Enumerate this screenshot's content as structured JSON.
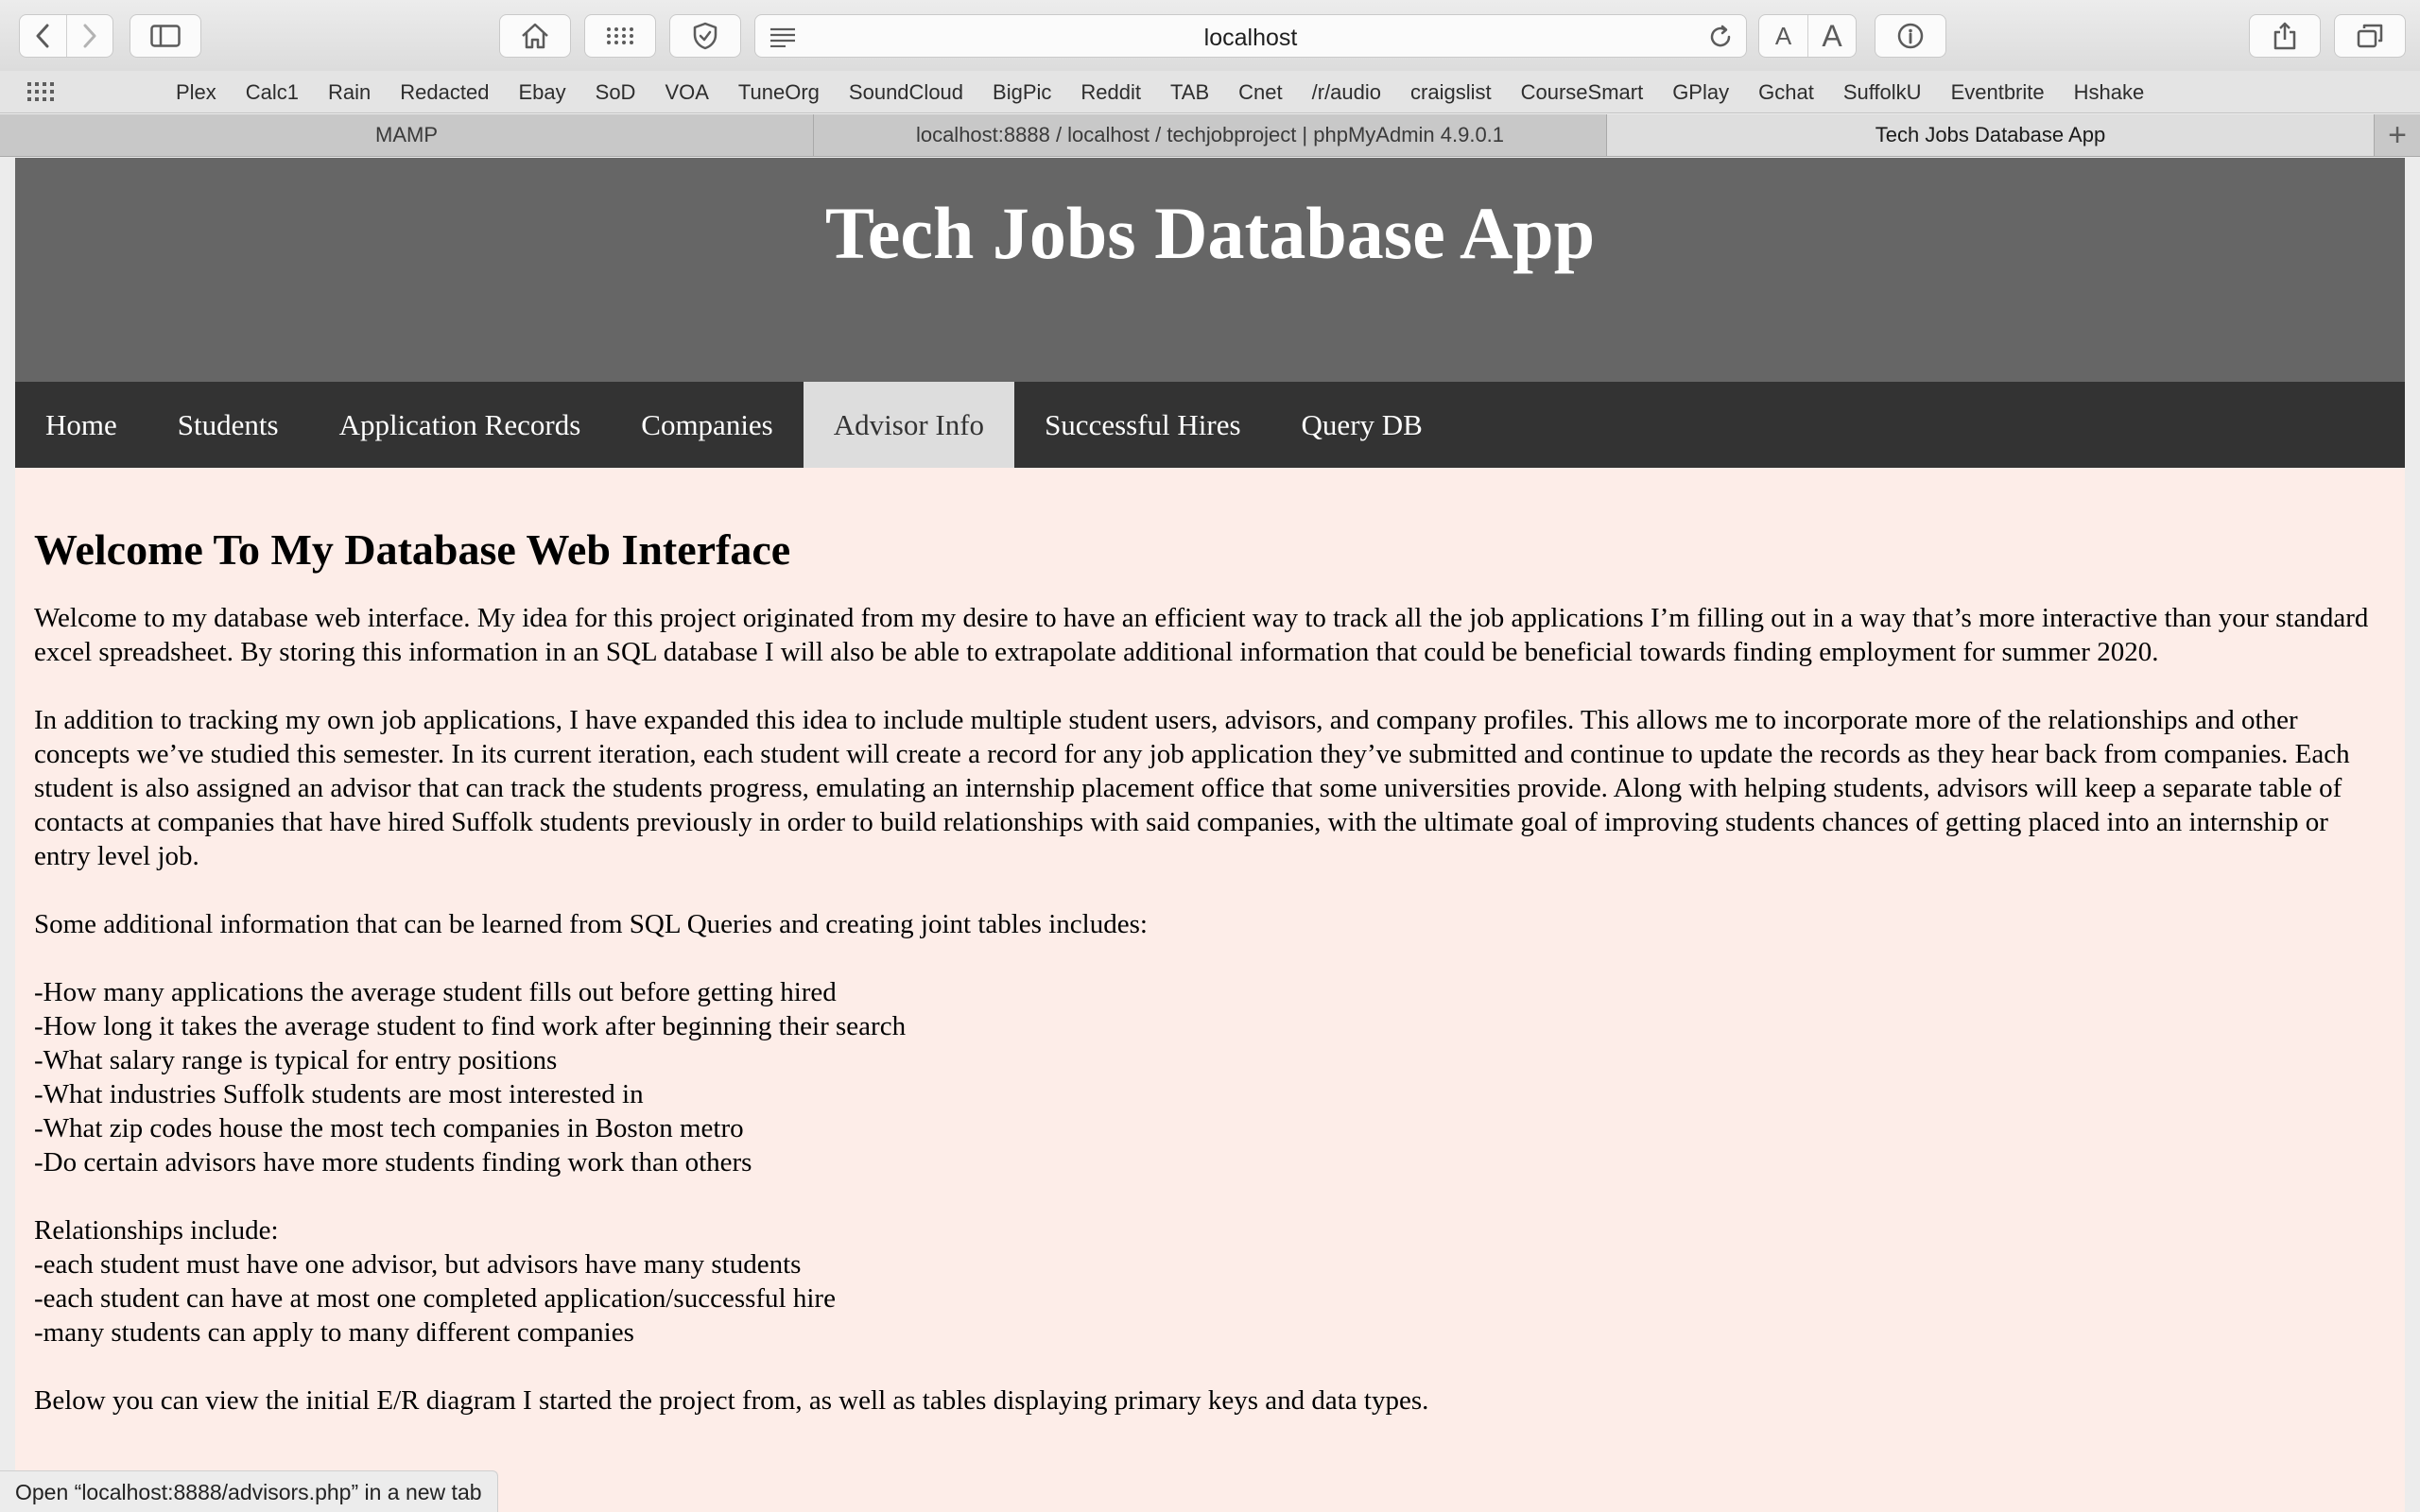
{
  "browser": {
    "address_url": "localhost",
    "favorites": [
      "Plex",
      "Calc1",
      "Rain",
      "Redacted",
      "Ebay",
      "SoD",
      "VOA",
      "TuneOrg",
      "SoundCloud",
      "BigPic",
      "Reddit",
      "TAB",
      "Cnet",
      "/r/audio",
      "craigslist",
      "CourseSmart",
      "GPlay",
      "Gchat",
      "SuffolkU",
      "Eventbrite",
      "Hshake"
    ],
    "tabs": [
      {
        "label": "MAMP"
      },
      {
        "label": "localhost:8888 / localhost / techjobproject | phpMyAdmin 4.9.0.1"
      },
      {
        "label": "Tech Jobs Database App"
      }
    ],
    "new_tab_label": "+",
    "font_small_label": "A",
    "font_large_label": "A",
    "status_text": "Open “localhost:8888/advisors.php” in a new tab"
  },
  "site": {
    "title": "Tech Jobs Database App",
    "nav": [
      {
        "label": "Home"
      },
      {
        "label": "Students"
      },
      {
        "label": "Application Records"
      },
      {
        "label": "Companies"
      },
      {
        "label": "Advisor Info"
      },
      {
        "label": "Successful Hires"
      },
      {
        "label": "Query DB"
      }
    ],
    "heading": "Welcome To My Database Web Interface",
    "intro1": "Welcome to my database web interface. My idea for this project originated from my desire to have an efficient way to track all the job applications I’m filling out in a way that’s more interactive than your standard excel spreadsheet. By storing this information in an SQL database I will also be able to extrapolate additional information that could be beneficial towards finding employment for summer 2020.",
    "intro2": "In addition to tracking my own job applications, I have expanded this idea to include multiple student users, advisors, and company profiles. This allows me to incorporate more of the relationships and other concepts we’ve studied this semester. In its current iteration, each student will create a record for any job application they’ve submitted and continue to update the records as they hear back from companies. Each student is also assigned an advisor that can track the students progress, emulating an internship placement office that some universities provide. Along with helping students, advisors will keep a separate table of contacts at companies that have hired Suffolk students previously in order to build relationships with said companies, with the ultimate goal of improving students chances of getting placed into an internship or entry level job.",
    "queries_intro": "Some additional information that can be learned from SQL Queries and creating joint tables includes:",
    "queries": [
      "-How many applications the average student fills out before getting hired",
      "-How long it takes the average student to find work after beginning their search",
      "-What salary range is typical for entry positions",
      "-What industries Suffolk students are most interested in",
      "-What zip codes house the most tech companies in Boston metro",
      "-Do certain advisors have more students finding work than others"
    ],
    "relationships_intro": "Relationships include:",
    "relationships": [
      "-each student must have one advisor, but advisors have many students",
      "-each student can have at most one completed application/successful hire",
      "-many students can apply to many different companies"
    ],
    "closing": "Below you can view the initial E/R diagram I started the project from, as well as tables displaying primary keys and data types."
  },
  "colors": {
    "header_bg": "#666666",
    "nav_bg": "#333333",
    "nav_active_bg": "#dddddd",
    "page_bg": "#fdede8"
  }
}
